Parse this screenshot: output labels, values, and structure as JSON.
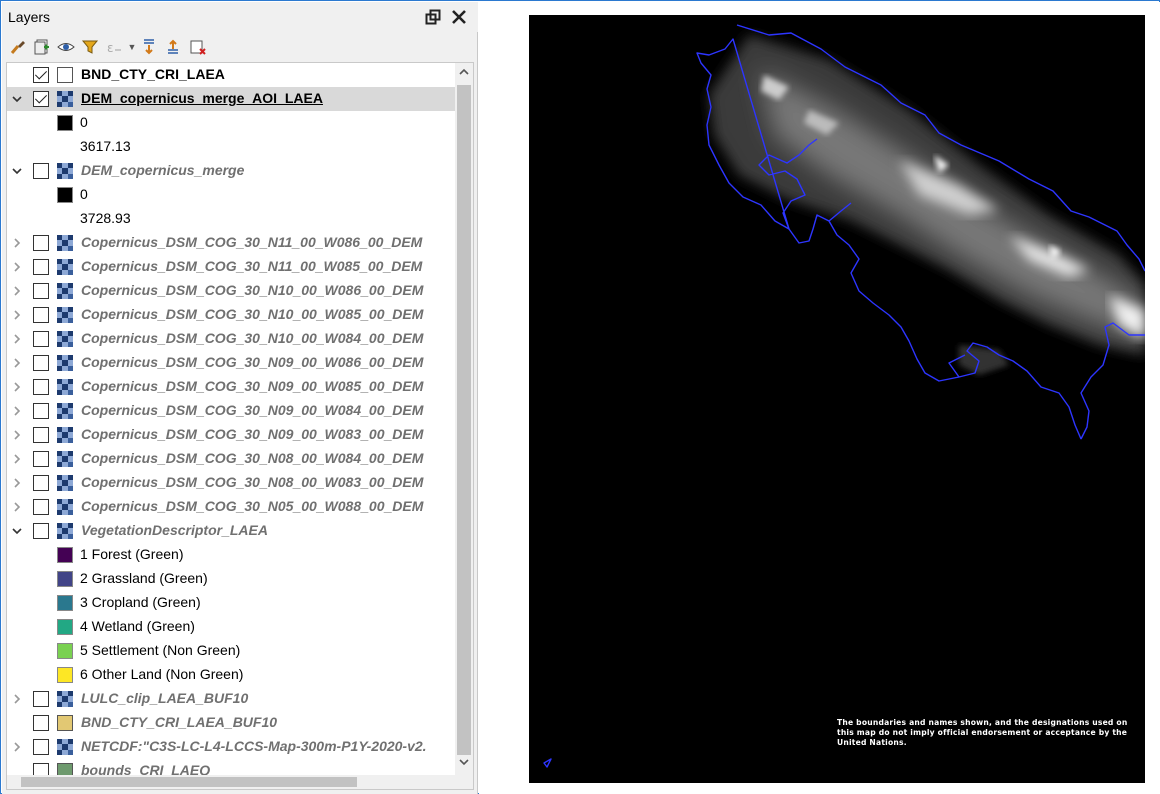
{
  "panel": {
    "title": "Layers"
  },
  "toolbar": {
    "buttons": [
      "style-manager",
      "add-group",
      "manage-visibility",
      "filter-legend",
      "expression-filter",
      "expand-all",
      "collapse-all",
      "remove-layer"
    ]
  },
  "layers": [
    {
      "name": "BND_CTY_CRI_LAEA",
      "checked": true,
      "icon": "polygon-icon",
      "swatch": "#ffffff",
      "expander": "none",
      "active": true
    },
    {
      "name": "DEM_copernicus_merge_AOI_LAEA",
      "checked": true,
      "icon": "raster-icon",
      "expander": "open",
      "active": true,
      "selected": true,
      "underline": true
    },
    {
      "legend": true,
      "swatch": "#000000",
      "label": "0"
    },
    {
      "legend": true,
      "label": "3617.13"
    },
    {
      "name": "DEM_copernicus_merge",
      "checked": false,
      "icon": "raster-icon",
      "expander": "open",
      "active": false
    },
    {
      "legend": true,
      "swatch": "#000000",
      "label": "0"
    },
    {
      "legend": true,
      "label": "3728.93"
    },
    {
      "name": "Copernicus_DSM_COG_30_N11_00_W086_00_DEM",
      "checked": false,
      "icon": "raster-icon",
      "expander": "closed",
      "active": false
    },
    {
      "name": "Copernicus_DSM_COG_30_N11_00_W085_00_DEM",
      "checked": false,
      "icon": "raster-icon",
      "expander": "closed",
      "active": false
    },
    {
      "name": "Copernicus_DSM_COG_30_N10_00_W086_00_DEM",
      "checked": false,
      "icon": "raster-icon",
      "expander": "closed",
      "active": false
    },
    {
      "name": "Copernicus_DSM_COG_30_N10_00_W085_00_DEM",
      "checked": false,
      "icon": "raster-icon",
      "expander": "closed",
      "active": false
    },
    {
      "name": "Copernicus_DSM_COG_30_N10_00_W084_00_DEM",
      "checked": false,
      "icon": "raster-icon",
      "expander": "closed",
      "active": false
    },
    {
      "name": "Copernicus_DSM_COG_30_N09_00_W086_00_DEM",
      "checked": false,
      "icon": "raster-icon",
      "expander": "closed",
      "active": false
    },
    {
      "name": "Copernicus_DSM_COG_30_N09_00_W085_00_DEM",
      "checked": false,
      "icon": "raster-icon",
      "expander": "closed",
      "active": false
    },
    {
      "name": "Copernicus_DSM_COG_30_N09_00_W084_00_DEM",
      "checked": false,
      "icon": "raster-icon",
      "expander": "closed",
      "active": false
    },
    {
      "name": "Copernicus_DSM_COG_30_N09_00_W083_00_DEM",
      "checked": false,
      "icon": "raster-icon",
      "expander": "closed",
      "active": false
    },
    {
      "name": "Copernicus_DSM_COG_30_N08_00_W084_00_DEM",
      "checked": false,
      "icon": "raster-icon",
      "expander": "closed",
      "active": false
    },
    {
      "name": "Copernicus_DSM_COG_30_N08_00_W083_00_DEM",
      "checked": false,
      "icon": "raster-icon",
      "expander": "closed",
      "active": false
    },
    {
      "name": "Copernicus_DSM_COG_30_N05_00_W088_00_DEM",
      "checked": false,
      "icon": "raster-icon",
      "expander": "closed",
      "active": false
    },
    {
      "name": "VegetationDescriptor_LAEA",
      "checked": false,
      "icon": "raster-icon",
      "expander": "open",
      "active": false
    },
    {
      "legend": true,
      "swatch": "#440154",
      "label": "1 Forest (Green)"
    },
    {
      "legend": true,
      "swatch": "#414487",
      "label": "2 Grassland (Green)"
    },
    {
      "legend": true,
      "swatch": "#2a788e",
      "label": "3 Cropland (Green)"
    },
    {
      "legend": true,
      "swatch": "#22a884",
      "label": "4 Wetland (Green)"
    },
    {
      "legend": true,
      "swatch": "#7ad151",
      "label": "5 Settlement (Non Green)"
    },
    {
      "legend": true,
      "swatch": "#fde725",
      "label": "6 Other Land (Non Green)"
    },
    {
      "name": "LULC_clip_LAEA_BUF10",
      "checked": false,
      "icon": "raster-icon",
      "expander": "closed",
      "active": false
    },
    {
      "name": "BND_CTY_CRI_LAEA_BUF10",
      "checked": false,
      "icon": "polygon-icon",
      "swatch": "#e2c873",
      "expander": "none",
      "active": false
    },
    {
      "name": "NETCDF:\"C3S-LC-L4-LCCS-Map-300m-P1Y-2020-v2.",
      "checked": false,
      "icon": "raster-icon",
      "expander": "closed",
      "active": false
    },
    {
      "name": "bounds_CRI_LAEQ",
      "checked": false,
      "icon": "polygon-icon",
      "swatch": "#6e9a6e",
      "expander": "none",
      "active": false
    }
  ],
  "map": {
    "background": "#000000",
    "boundary_color": "#2d35ff",
    "disclaimer": "The boundaries and names shown, and the designations used on this map do not imply official endorsement or acceptance by the United Nations."
  }
}
